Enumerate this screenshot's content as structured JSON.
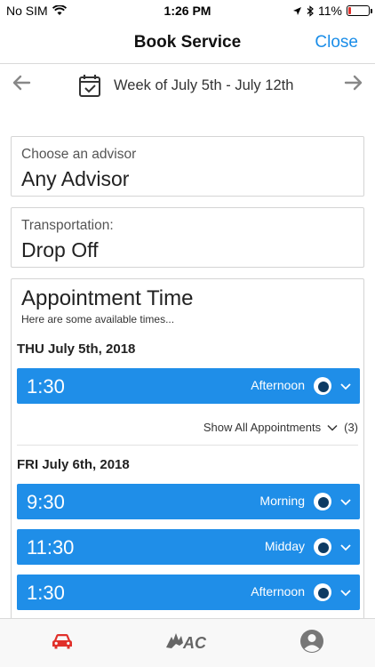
{
  "status_bar": {
    "carrier": "No SIM",
    "time": "1:26 PM",
    "battery": "11%",
    "battery_level": 0.11
  },
  "nav": {
    "title": "Book Service",
    "close_label": "Close"
  },
  "week": {
    "label": "Week of July 5th - July 12th",
    "prev_icon": "arrow-left-icon",
    "next_icon": "arrow-right-icon"
  },
  "advisor": {
    "caption": "Choose an advisor",
    "value": "Any Advisor"
  },
  "transport": {
    "caption": "Transportation:",
    "value": "Drop Off"
  },
  "appointment": {
    "heading": "Appointment Time",
    "subtitle": "Here are some available times...",
    "days": [
      {
        "label": "THU July 5th, 2018",
        "slots": [
          {
            "time": "1:30",
            "period": "Afternoon"
          }
        ],
        "show_all": "Show All Appointments",
        "show_all_count": "(3)"
      },
      {
        "label": "FRI July 6th, 2018",
        "slots": [
          {
            "time": "9:30",
            "period": "Morning"
          },
          {
            "time": "11:30",
            "period": "Midday"
          },
          {
            "time": "1:30",
            "period": "Afternoon"
          }
        ]
      }
    ]
  },
  "tabs": [
    {
      "icon": "car-icon",
      "active": true
    },
    {
      "icon": "ac-logo-icon",
      "active": false
    },
    {
      "icon": "profile-icon",
      "active": false
    }
  ],
  "colors": {
    "accent": "#1f8ee8",
    "link": "#1a8de8",
    "active_tab": "#e0302a"
  }
}
